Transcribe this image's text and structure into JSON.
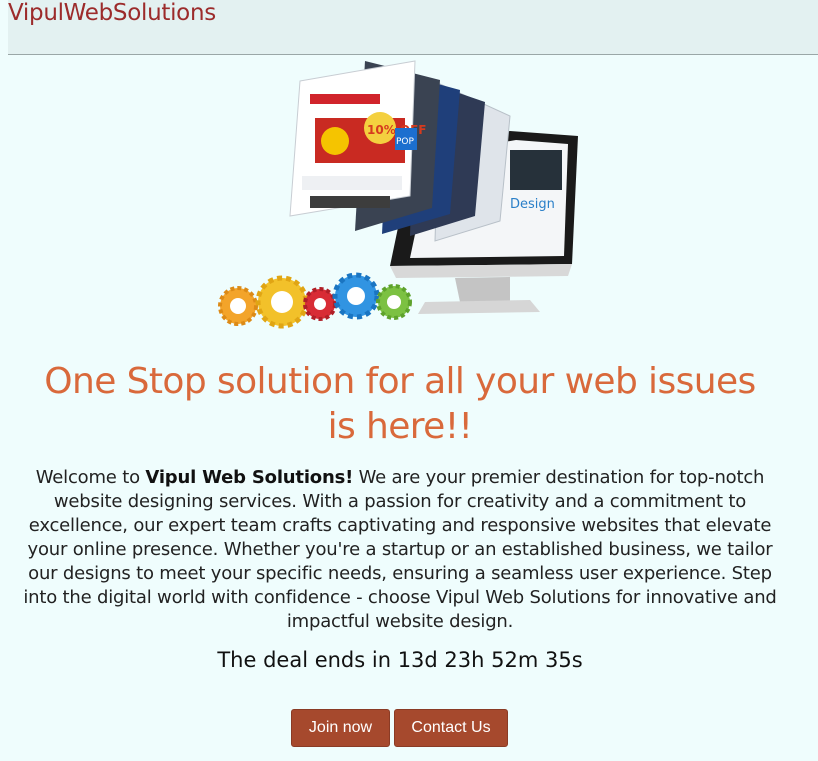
{
  "brand": {
    "name": "VipulWebSolutions"
  },
  "hero": {
    "headline_line1": "One Stop solution for all your web issues",
    "headline_line2": "is here!!",
    "intro_prefix": "Welcome to ",
    "intro_bold": "Vipul Web Solutions!",
    "intro_rest": " We are your premier destination for top-notch website designing services. With a passion for creativity and a commitment to excellence, our expert team crafts captivating and responsive websites that elevate your online presence. Whether you're a startup or an established business, we tailor our designs to meet your specific needs, ensuring a seamless user experience. Step into the digital world with confidence - choose Vipul Web Solutions for innovative and impactful website design.",
    "image_texts": {
      "design": "Design",
      "sale": "10% OFF",
      "pop": "POP"
    }
  },
  "countdown": {
    "text": "The deal ends in 13d 23h 52m 35s"
  },
  "buttons": {
    "join": "Join now",
    "contact": "Contact Us"
  },
  "colors": {
    "brand": "#9c2b2b",
    "headline": "#d9693b",
    "button": "#a6492d",
    "background": "#effdfd"
  }
}
